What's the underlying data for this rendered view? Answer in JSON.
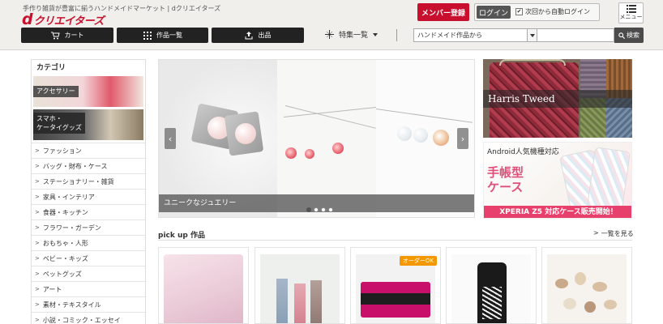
{
  "header": {
    "tagline": "手作り雑貨が豊富に揃うハンドメイドマーケット | dクリエイターズ",
    "logo": {
      "d": "d",
      "text": "クリエイターズ"
    },
    "nav": [
      {
        "label": "カート",
        "icon": "cart-icon"
      },
      {
        "label": "作品一覧",
        "icon": "grid-icon"
      },
      {
        "label": "出品",
        "icon": "upload-icon"
      }
    ],
    "feature_label": "特集一覧",
    "search": {
      "category": "ハンドメイド作品から",
      "query": "",
      "button": "検索"
    },
    "member_button": "メンバー登録",
    "login_button": "ログイン",
    "auto_login": "次回から自動ログイン",
    "menu_label": "メニュー"
  },
  "sidebar": {
    "title": "カテゴリ",
    "banners": [
      "アクセサリー",
      "スマホ・\nケータイグッズ"
    ],
    "items": [
      "ファッション",
      "バッグ・財布・ケース",
      "ステーショナリー・雑貨",
      "家具・インテリア",
      "食器・キッチン",
      "フラワー・ガーデン",
      "おもちゃ・人形",
      "ベビー・キッズ",
      "ペットグッズ",
      "アート",
      "素材・テキスタイル",
      "小説・コミック・エッセイ"
    ]
  },
  "slider": {
    "caption": "ユニークなジュエリー",
    "slide_count": 4,
    "active_index": 0
  },
  "banners": {
    "harris": "Harris Tweed",
    "android_title": "Android人気機種対応",
    "android_big": "手帳型\nケース",
    "android_bottom": "XPERIA Z5 対応ケース販売開始！"
  },
  "pickup": {
    "title": "pick up 作品",
    "more": "一覧を見る",
    "badge": "オーダーOK"
  },
  "colors": {
    "brand": "#c8102e",
    "dark": "#222222",
    "badge": "#f39800"
  }
}
